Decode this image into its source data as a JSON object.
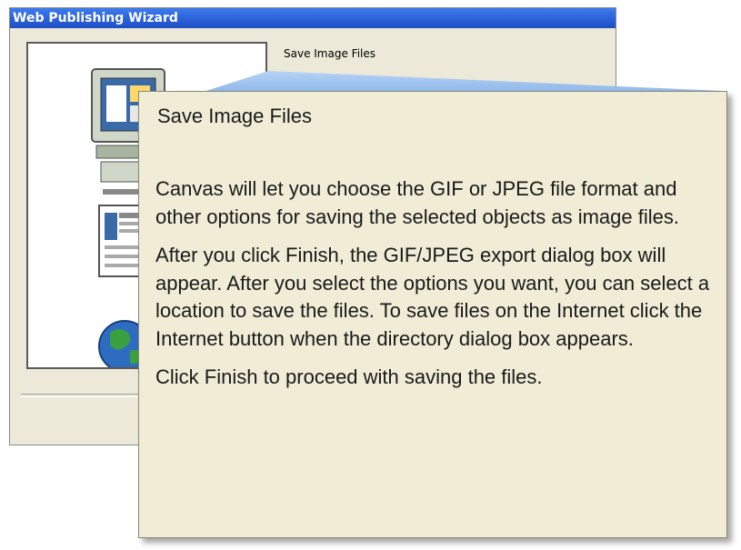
{
  "window": {
    "title": "Web Publishing Wizard"
  },
  "wizard": {
    "step_title": "Save Image Files"
  },
  "balloon": {
    "title": "Save Image Files",
    "paragraphs": [
      "Canvas will let you choose the GIF or JPEG file format and other options for saving the selected objects as image files.",
      "After you click Finish, the GIF/JPEG export dialog box will appear. After you select the options you want, you can select a location to save the files. To save files on the Internet click the Internet button when the directory dialog box appears.",
      "Click Finish to proceed with saving the files."
    ]
  },
  "colors": {
    "titlebar": "#2c63db",
    "dialog_face": "#ece9d8",
    "balloon_face": "#f0ecd6",
    "pointer": "#9fc3f0"
  },
  "icons": [
    "computer-monitor-icon",
    "document-page-icon",
    "globe-icon"
  ]
}
